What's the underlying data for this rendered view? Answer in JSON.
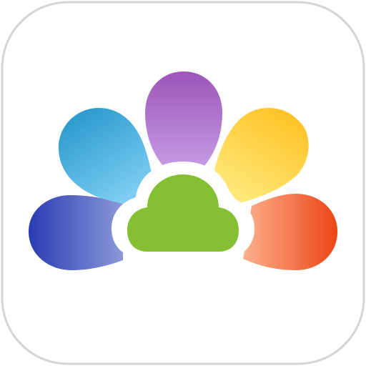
{
  "icon": {
    "name": "petal-cloud-app-icon",
    "frame_color": "#ffffff",
    "frame_border_color": "#d4d4d4",
    "petal_colors": {
      "dark_blue": [
        "#2a3bb3",
        "#8b99d8"
      ],
      "light_blue": [
        "#1f93c8",
        "#7ccdf1"
      ],
      "purple": [
        "#9b55b8",
        "#c69ae4"
      ],
      "yellow": [
        "#ffbd19",
        "#ffe878"
      ],
      "orange": [
        "#ec4515",
        "#fcb18e"
      ]
    },
    "cloud_color": "#85c034",
    "cloud_ring_color": "#ffffff"
  }
}
